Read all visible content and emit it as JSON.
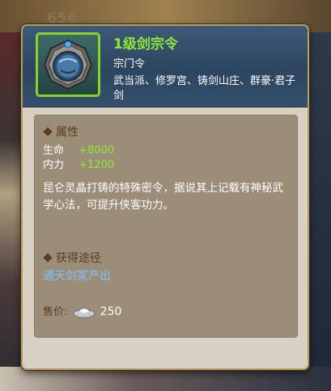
{
  "background": {
    "number": "656"
  },
  "item": {
    "name": "1级剑宗令",
    "type": "宗门令",
    "sects": "武当派、修罗宫、铸剑山庄、群豪·君子剑",
    "name_color": "#8ee83a",
    "frame_color": "#8bd12a",
    "icon": "sect-token-icon"
  },
  "attributes": {
    "title": "属性",
    "stats": [
      {
        "name": "生命",
        "value": "+8000"
      },
      {
        "name": "内力",
        "value": "+1200"
      }
    ]
  },
  "description": "昆仑灵晶打铸的特殊密令，据说其上记载有神秘武学心法，可提升侠客功力。",
  "source": {
    "title": "获得途径",
    "link": "通天剑冢产出"
  },
  "price": {
    "label": "售价:",
    "icon": "silver-ingot-icon",
    "value": "250"
  }
}
